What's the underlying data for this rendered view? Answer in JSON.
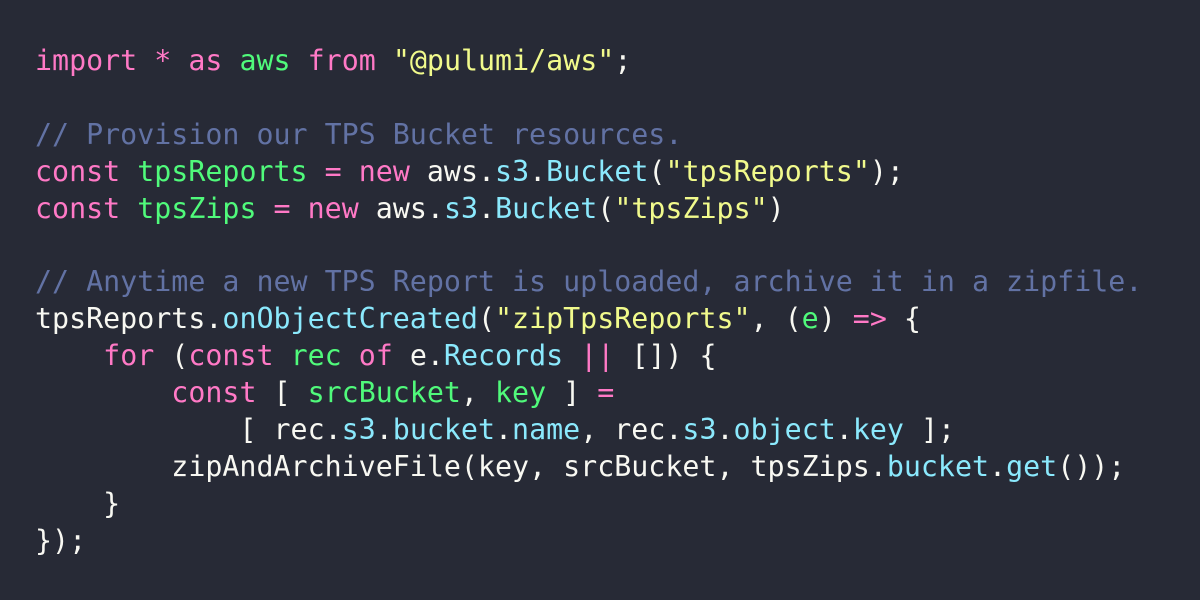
{
  "theme": {
    "background": "#272a36",
    "keyword": "#ff79c6",
    "variable": "#50fa7b",
    "string": "#f1fa8c",
    "comment": "#6272a4",
    "property": "#8be9fd",
    "plain": "#f8f8f2"
  },
  "lines": [
    [
      [
        "kw",
        "import"
      ],
      [
        "pl",
        " "
      ],
      [
        "kw",
        "*"
      ],
      [
        "pl",
        " "
      ],
      [
        "kw",
        "as"
      ],
      [
        "pl",
        " "
      ],
      [
        "var",
        "aws"
      ],
      [
        "pl",
        " "
      ],
      [
        "kw",
        "from"
      ],
      [
        "pl",
        " "
      ],
      [
        "str",
        "\"@pulumi/aws\""
      ],
      [
        "pl",
        ";"
      ]
    ],
    [],
    [
      [
        "cm",
        "// Provision our TPS Bucket resources."
      ]
    ],
    [
      [
        "kw",
        "const"
      ],
      [
        "pl",
        " "
      ],
      [
        "var",
        "tpsReports"
      ],
      [
        "pl",
        " "
      ],
      [
        "kw",
        "="
      ],
      [
        "pl",
        " "
      ],
      [
        "kw",
        "new"
      ],
      [
        "pl",
        " aws."
      ],
      [
        "fn",
        "s3"
      ],
      [
        "pl",
        "."
      ],
      [
        "fn",
        "Bucket"
      ],
      [
        "pl",
        "("
      ],
      [
        "str",
        "\"tpsReports\""
      ],
      [
        "pl",
        ");"
      ]
    ],
    [
      [
        "kw",
        "const"
      ],
      [
        "pl",
        " "
      ],
      [
        "var",
        "tpsZips"
      ],
      [
        "pl",
        " "
      ],
      [
        "kw",
        "="
      ],
      [
        "pl",
        " "
      ],
      [
        "kw",
        "new"
      ],
      [
        "pl",
        " aws."
      ],
      [
        "fn",
        "s3"
      ],
      [
        "pl",
        "."
      ],
      [
        "fn",
        "Bucket"
      ],
      [
        "pl",
        "("
      ],
      [
        "str",
        "\"tpsZips\""
      ],
      [
        "pl",
        ")"
      ]
    ],
    [],
    [
      [
        "cm",
        "// Anytime a new TPS Report is uploaded, archive it in a zipfile."
      ]
    ],
    [
      [
        "pl",
        "tpsReports."
      ],
      [
        "fn",
        "onObjectCreated"
      ],
      [
        "pl",
        "("
      ],
      [
        "str",
        "\"zipTpsReports\""
      ],
      [
        "pl",
        ", ("
      ],
      [
        "var",
        "e"
      ],
      [
        "pl",
        ") "
      ],
      [
        "kw",
        "=>"
      ],
      [
        "pl",
        " {"
      ]
    ],
    [
      [
        "pl",
        "    "
      ],
      [
        "kw",
        "for"
      ],
      [
        "pl",
        " ("
      ],
      [
        "kw",
        "const"
      ],
      [
        "pl",
        " "
      ],
      [
        "var",
        "rec"
      ],
      [
        "pl",
        " "
      ],
      [
        "kw",
        "of"
      ],
      [
        "pl",
        " e."
      ],
      [
        "fn",
        "Records"
      ],
      [
        "pl",
        " "
      ],
      [
        "kw",
        "||"
      ],
      [
        "pl",
        " []) {"
      ]
    ],
    [
      [
        "pl",
        "        "
      ],
      [
        "kw",
        "const"
      ],
      [
        "pl",
        " [ "
      ],
      [
        "var",
        "srcBucket"
      ],
      [
        "pl",
        ", "
      ],
      [
        "var",
        "key"
      ],
      [
        "pl",
        " ] "
      ],
      [
        "kw",
        "="
      ]
    ],
    [
      [
        "pl",
        "            [ rec."
      ],
      [
        "fn",
        "s3"
      ],
      [
        "pl",
        "."
      ],
      [
        "fn",
        "bucket"
      ],
      [
        "pl",
        "."
      ],
      [
        "fn",
        "name"
      ],
      [
        "pl",
        ", rec."
      ],
      [
        "fn",
        "s3"
      ],
      [
        "pl",
        "."
      ],
      [
        "fn",
        "object"
      ],
      [
        "pl",
        "."
      ],
      [
        "fn",
        "key"
      ],
      [
        "pl",
        " ];"
      ]
    ],
    [
      [
        "pl",
        "        zipAndArchiveFile(key, srcBucket, tpsZips."
      ],
      [
        "fn",
        "bucket"
      ],
      [
        "pl",
        "."
      ],
      [
        "fn",
        "get"
      ],
      [
        "pl",
        "());"
      ]
    ],
    [
      [
        "pl",
        "    }"
      ]
    ],
    [
      [
        "pl",
        "});"
      ]
    ]
  ]
}
